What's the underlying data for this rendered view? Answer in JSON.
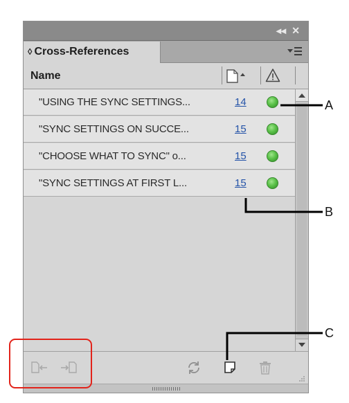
{
  "panel": {
    "title_buttons": {
      "collapse": "◂◂",
      "close": "✕"
    },
    "tab_arrows": "◊",
    "tab_label": "Cross-References",
    "column_headers": {
      "name": "Name"
    },
    "rows": [
      {
        "name": "\"USING THE SYNC SETTINGS...",
        "page": "14",
        "status": "ok"
      },
      {
        "name": "\"SYNC SETTINGS ON SUCCE...",
        "page": "15",
        "status": "ok"
      },
      {
        "name": "\"CHOOSE WHAT TO SYNC\" o...",
        "page": "15",
        "status": "ok"
      },
      {
        "name": "\"SYNC SETTINGS AT FIRST L...",
        "page": "15",
        "status": "ok"
      }
    ],
    "icons": {
      "panel_menu": "panel-menu-icon",
      "page_column": "page-sort-icon",
      "status_column": "warning-icon",
      "go_to_source": "go-to-source-icon",
      "go_to_destination": "go-to-destination-icon",
      "update": "refresh-icon",
      "create": "new-cross-reference-icon",
      "delete": "trash-icon"
    },
    "colors": {
      "status_ok": "#5cc24a",
      "page_link": "#2453a8",
      "highlight": "#e2231a"
    }
  },
  "callouts": {
    "a": "A",
    "b": "B",
    "c": "C"
  }
}
